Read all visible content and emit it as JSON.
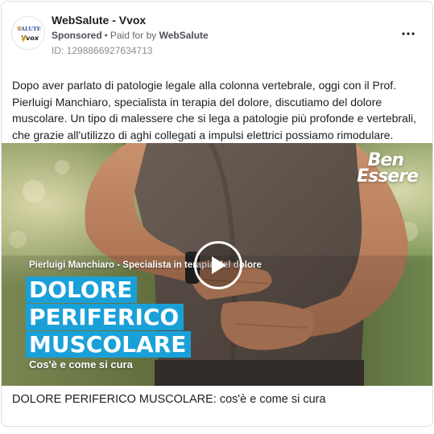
{
  "post": {
    "page_name": "WebSalute - Vvox",
    "sponsored_label": "Sponsored",
    "paid_for_prefix": "Paid for by",
    "paid_for_name": "WebSalute",
    "ad_id": "ID: 1298866927634713",
    "avatar_logo_text": "SALUTE",
    "avatar_logo_sub": "Vvox",
    "body_text": "Dopo aver parlato di patologie legale alla colonna vertebrale, oggi con il Prof. Pierluigi Manchiaro, specialista in terapia del dolore, discutiamo del dolore muscolare. Un tipo di malessere che si lega a patologie più profonde e vertebrali, che grazie all'utilizzo di aghi collegati a impulsi elettrici possiamo rimodulare."
  },
  "media": {
    "brand_line1": "Ben",
    "brand_line2": "Essere",
    "speaker": "Pierluigi Manchiaro - Specialista in terapia del dolore",
    "headline": [
      "DOLORE",
      "PERIFERICO",
      "MUSCOLARE"
    ],
    "sub_headline": "Cos'è e come si cura",
    "accent_color": "#1aa0d8",
    "play_icon": "play-icon"
  },
  "caption": "DOLORE PERIFERICO MUSCOLARE: cos'è e come si cura",
  "icons": {
    "more": "more-horizontal-icon"
  }
}
